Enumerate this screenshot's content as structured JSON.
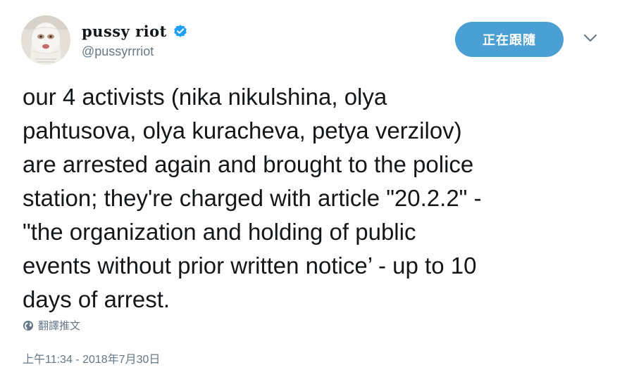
{
  "author": {
    "display_name": "pussy riot",
    "handle": "@pussyrrriot",
    "verified": true,
    "avatar_description": "person wearing white balaclava"
  },
  "actions": {
    "follow_label": "正在跟隨",
    "caret_icon": "chevron-down-icon"
  },
  "tweet": {
    "text": "our 4 activists (nika nikulshina, olya\npahtusova, olya kuracheva, petya verzilov)\nare arrested again and brought to the police\nstation; they're charged with article \"20.2.2\" -\n\"the organization and holding of public\nevents without prior written notice’ - up to 10\ndays of arrest.",
    "translate_label": "翻譯推文",
    "timestamp": "上午11:34 - 2018年7月30日"
  },
  "colors": {
    "accent": "#4a9fd3",
    "verified": "#1da1f2",
    "secondary_text": "#657786",
    "primary_text": "#14171a"
  }
}
